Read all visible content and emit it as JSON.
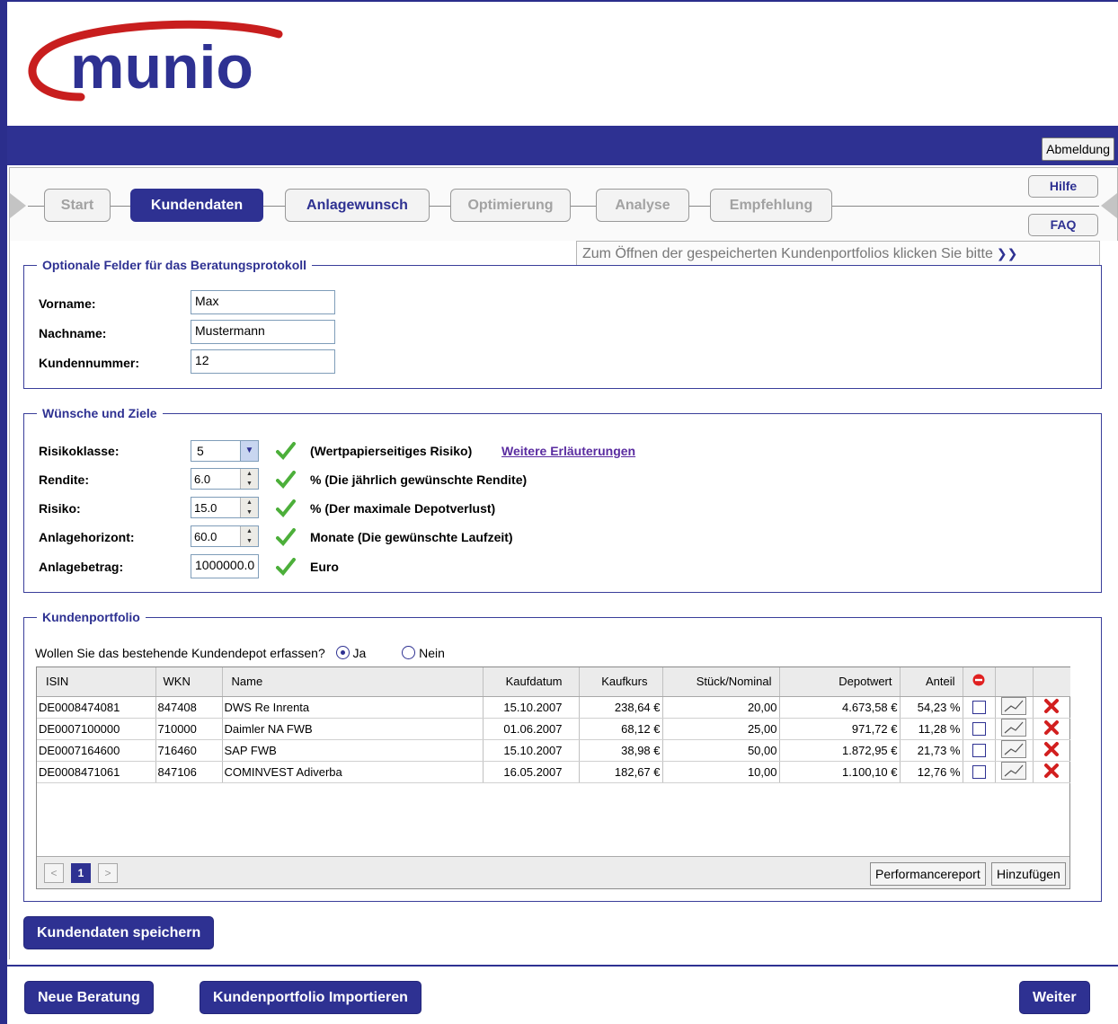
{
  "brand": {
    "logo_text": "munio",
    "accent": "#2e3192",
    "logo_swoosh": "#c81e1e"
  },
  "header": {
    "logout_label": "Abmeldung"
  },
  "nav": {
    "steps": [
      {
        "label": "Start"
      },
      {
        "label": "Kundendaten"
      },
      {
        "label": "Anlagewunsch"
      },
      {
        "label": "Optimierung"
      },
      {
        "label": "Analyse"
      },
      {
        "label": "Empfehlung"
      }
    ],
    "help_label": "Hilfe",
    "faq_label": "FAQ",
    "portfolio_hint": "Zum Öffnen der gespeicherten Kundenportfolios klicken Sie bitte"
  },
  "protocol": {
    "legend": "Optionale Felder für das Beratungsprotokoll",
    "fields": [
      {
        "label": "Vorname:",
        "value": "Max"
      },
      {
        "label": "Nachname:",
        "value": "Mustermann"
      },
      {
        "label": "Kundennummer:",
        "value": "12"
      }
    ]
  },
  "goals": {
    "legend": "Wünsche und Ziele",
    "risk_class": {
      "label": "Risikoklasse:",
      "value": "5",
      "desc": "(Wertpapierseitiges Risiko)",
      "link": "Weitere Erläuterungen"
    },
    "rendite": {
      "label": "Rendite:",
      "value": "6.0",
      "desc": "% (Die jährlich gewünschte Rendite)"
    },
    "risiko": {
      "label": "Risiko:",
      "value": "15.0",
      "desc": "% (Der maximale Depotverlust)"
    },
    "horizont": {
      "label": "Anlagehorizont:",
      "value": "60.0",
      "desc": "Monate (Die gewünschte Laufzeit)"
    },
    "betrag": {
      "label": "Anlagebetrag:",
      "value": "1000000.0",
      "desc": "Euro"
    }
  },
  "portfolio": {
    "legend": "Kundenportfolio",
    "question": "Wollen Sie das bestehende Kundendepot erfassen?",
    "yes": "Ja",
    "no": "Nein",
    "columns": [
      "ISIN",
      "WKN",
      "Name",
      "Kaufdatum",
      "Kaufkurs",
      "Stück/Nominal",
      "Depotwert",
      "Anteil"
    ],
    "rows": [
      [
        "DE0008474081",
        "847408",
        "DWS Re Inrenta",
        "15.10.2007",
        "238,64 €",
        "20,00",
        "4.673,58 €",
        "54,23 %"
      ],
      [
        "DE0007100000",
        "710000",
        "Daimler NA FWB",
        "01.06.2007",
        "68,12 €",
        "25,00",
        "971,72 €",
        "11,28 %"
      ],
      [
        "DE0007164600",
        "716460",
        "SAP FWB",
        "15.10.2007",
        "38,98 €",
        "50,00",
        "1.872,95 €",
        "21,73 %"
      ],
      [
        "DE0008471061",
        "847106",
        "COMINVEST Adiverba",
        "16.05.2007",
        "182,67 €",
        "10,00",
        "1.100,10 €",
        "12,76 %"
      ]
    ],
    "page": "1",
    "performance_label": "Performancereport",
    "add_label": "Hinzufügen"
  },
  "actions": {
    "save": "Kundendaten speichern",
    "new": "Neue Beratung",
    "import": "Kundenportfolio Importieren",
    "next": "Weiter"
  }
}
